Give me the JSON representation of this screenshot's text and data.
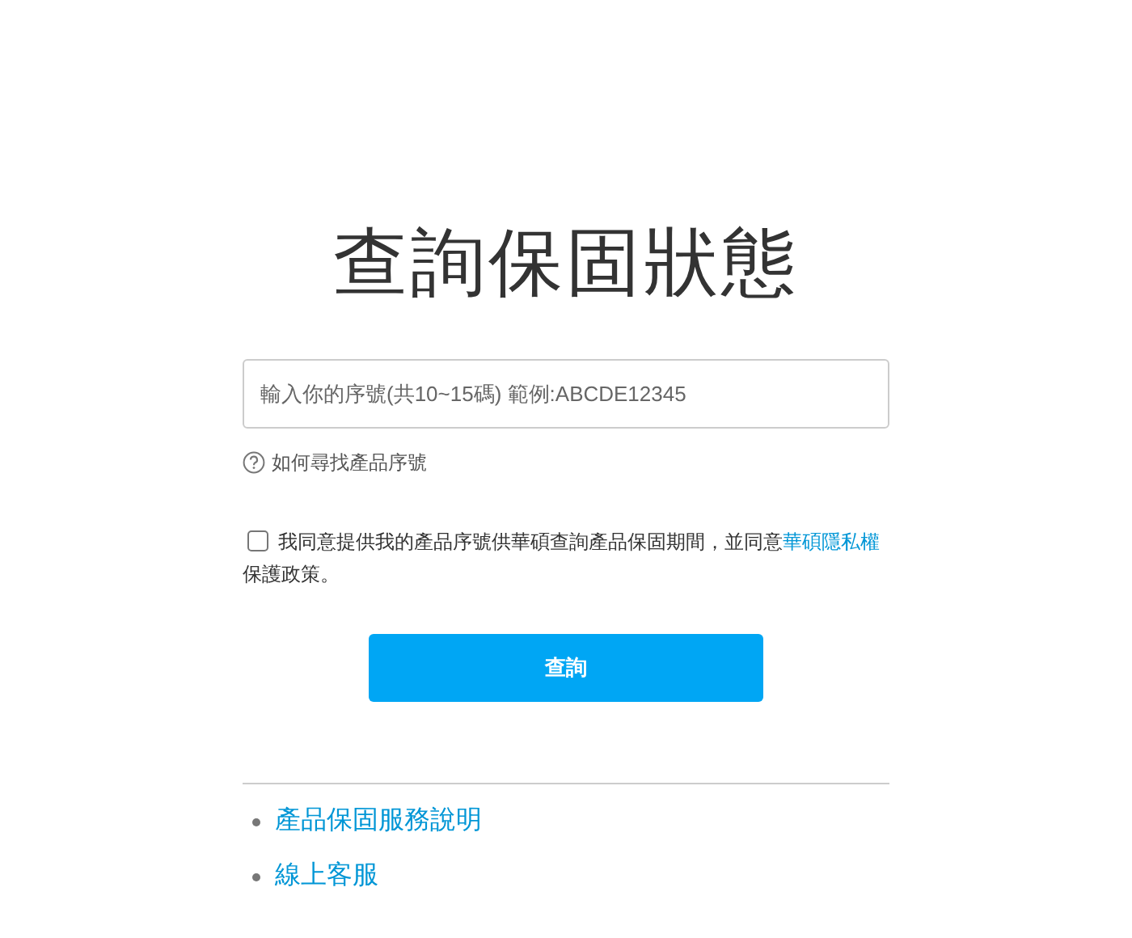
{
  "title": "查詢保固狀態",
  "serial_field": {
    "placeholder": "輸入你的序號(共10~15碼) 範例:ABCDE12345"
  },
  "help_link": {
    "label": "如何尋找產品序號"
  },
  "consent": {
    "checked": false,
    "text_before": "我同意提供我的產品序號供華碩查詢產品保固期間，並同意",
    "link": "華碩隱私權",
    "text_after": "保護政策。"
  },
  "submit_button": {
    "label": "查詢"
  },
  "links": [
    {
      "label": "產品保固服務說明"
    },
    {
      "label": "線上客服"
    }
  ]
}
